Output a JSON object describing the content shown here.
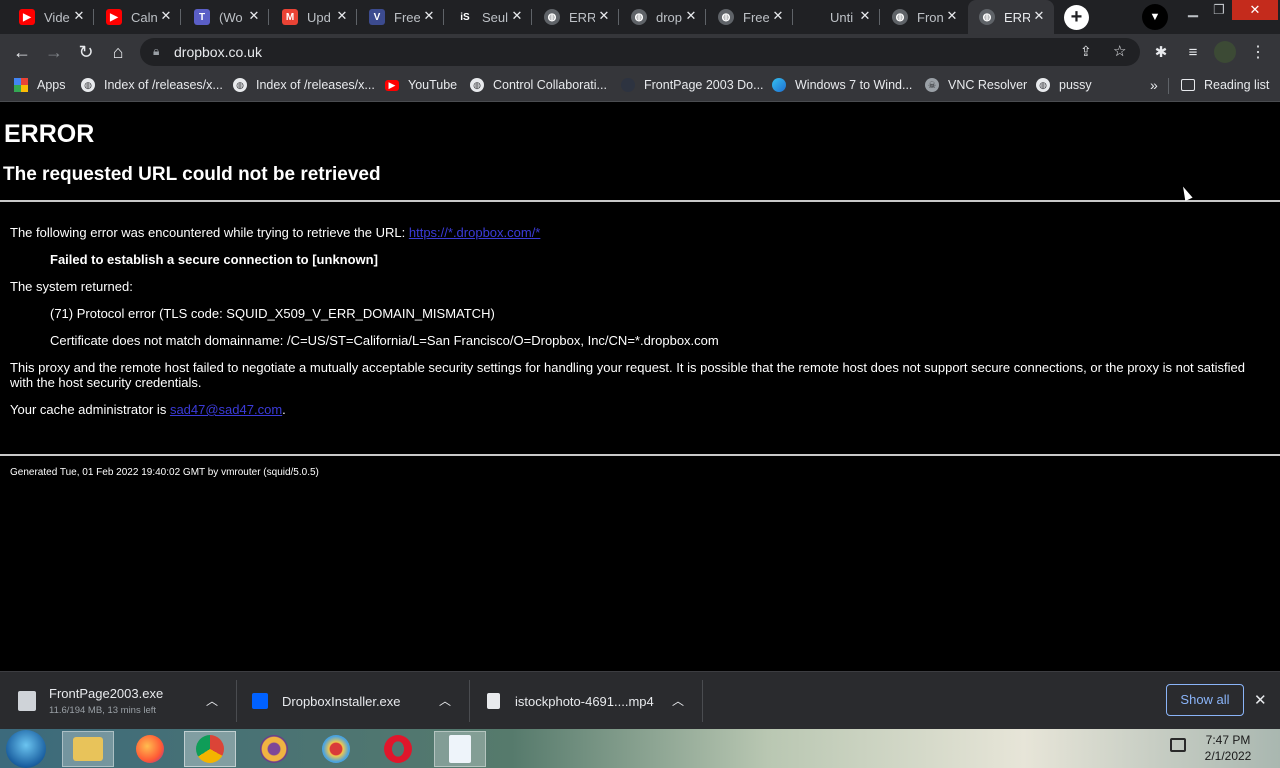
{
  "tabs": [
    {
      "title": "Vide",
      "icon": "youtube-icon",
      "color": "#ff0000"
    },
    {
      "title": "Caln",
      "icon": "youtube-icon",
      "color": "#ff0000"
    },
    {
      "title": "(Wo",
      "icon": "teams-icon",
      "color": "#5b5fc7"
    },
    {
      "title": "Upd",
      "icon": "gmail-icon",
      "color": "#ea4335"
    },
    {
      "title": "Free",
      "icon": "v-logo-icon",
      "color": "#3c4b8f"
    },
    {
      "title": "Seul",
      "icon": "istock-icon",
      "color": "#202124"
    },
    {
      "title": "ERR",
      "icon": "globe-icon",
      "color": "#5f6368"
    },
    {
      "title": "drop",
      "icon": "globe-icon",
      "color": "#5f6368"
    },
    {
      "title": "Free",
      "icon": "globe-icon",
      "color": "#5f6368"
    },
    {
      "title": "Unti",
      "icon": "blank-icon",
      "color": "#202124"
    },
    {
      "title": "Fron",
      "icon": "globe-icon",
      "color": "#5f6368"
    },
    {
      "title": "ERR",
      "icon": "globe-icon",
      "color": "#5f6368",
      "active": true
    }
  ],
  "address": {
    "url": "dropbox.co.uk"
  },
  "bookmarks": [
    {
      "label": "Apps",
      "icon": "apps-grid-icon"
    },
    {
      "label": "Index of /releases/x...",
      "icon": "globe-icon"
    },
    {
      "label": "Index of /releases/x...",
      "icon": "globe-icon"
    },
    {
      "label": "YouTube",
      "icon": "youtube-icon"
    },
    {
      "label": "Control Collaborati...",
      "icon": "globe-icon"
    },
    {
      "label": "FrontPage 2003 Do...",
      "icon": "blank-icon"
    },
    {
      "label": "Windows 7 to Wind...",
      "icon": "edge-icon"
    },
    {
      "label": "VNC Resolver",
      "icon": "vnc-icon"
    },
    {
      "label": "pussy",
      "icon": "globe-icon"
    }
  ],
  "bookmarks_more": "»",
  "reading_list": "Reading list",
  "page": {
    "h1": "ERROR",
    "h2": "The requested URL could not be retrieved",
    "line1_prefix": "The following error was encountered while trying to retrieve the URL: ",
    "line1_link": "https://*.dropbox.com/*",
    "failed": "Failed to establish a secure connection to [unknown]",
    "system_returned": "The system returned:",
    "protocol_error": "(71) Protocol error (TLS code: SQUID_X509_V_ERR_DOMAIN_MISMATCH)",
    "cert": "Certificate does not match domainname: /C=US/ST=California/L=San Francisco/O=Dropbox, Inc/CN=*.dropbox.com",
    "proxy_text": "This proxy and the remote host failed to negotiate a mutually acceptable security settings for handling your request. It is possible that the remote host does not support secure connections, or the proxy is not satisfied with the host security credentials.",
    "admin_prefix": "Your cache administrator is ",
    "admin_link": "sad47@sad47.com",
    "admin_suffix": ".",
    "generated": "Generated Tue, 01 Feb 2022 19:40:02 GMT by vmrouter (squid/5.0.5)"
  },
  "downloads": [
    {
      "name": "FrontPage2003.exe",
      "meta": "11.6/194 MB, 13 mins left",
      "icon": "exe-file-icon"
    },
    {
      "name": "DropboxInstaller.exe",
      "meta": "",
      "icon": "dropbox-icon"
    },
    {
      "name": "istockphoto-4691....mp4",
      "meta": "",
      "icon": "file-icon"
    }
  ],
  "show_all": "Show all",
  "taskbar": {
    "time": "7:47 PM",
    "date": "2/1/2022"
  },
  "colors": {
    "link": "#3b3bd8",
    "accent": "#8ab4f8",
    "chrome_dark": "#202124",
    "toolbar": "#35363a"
  }
}
